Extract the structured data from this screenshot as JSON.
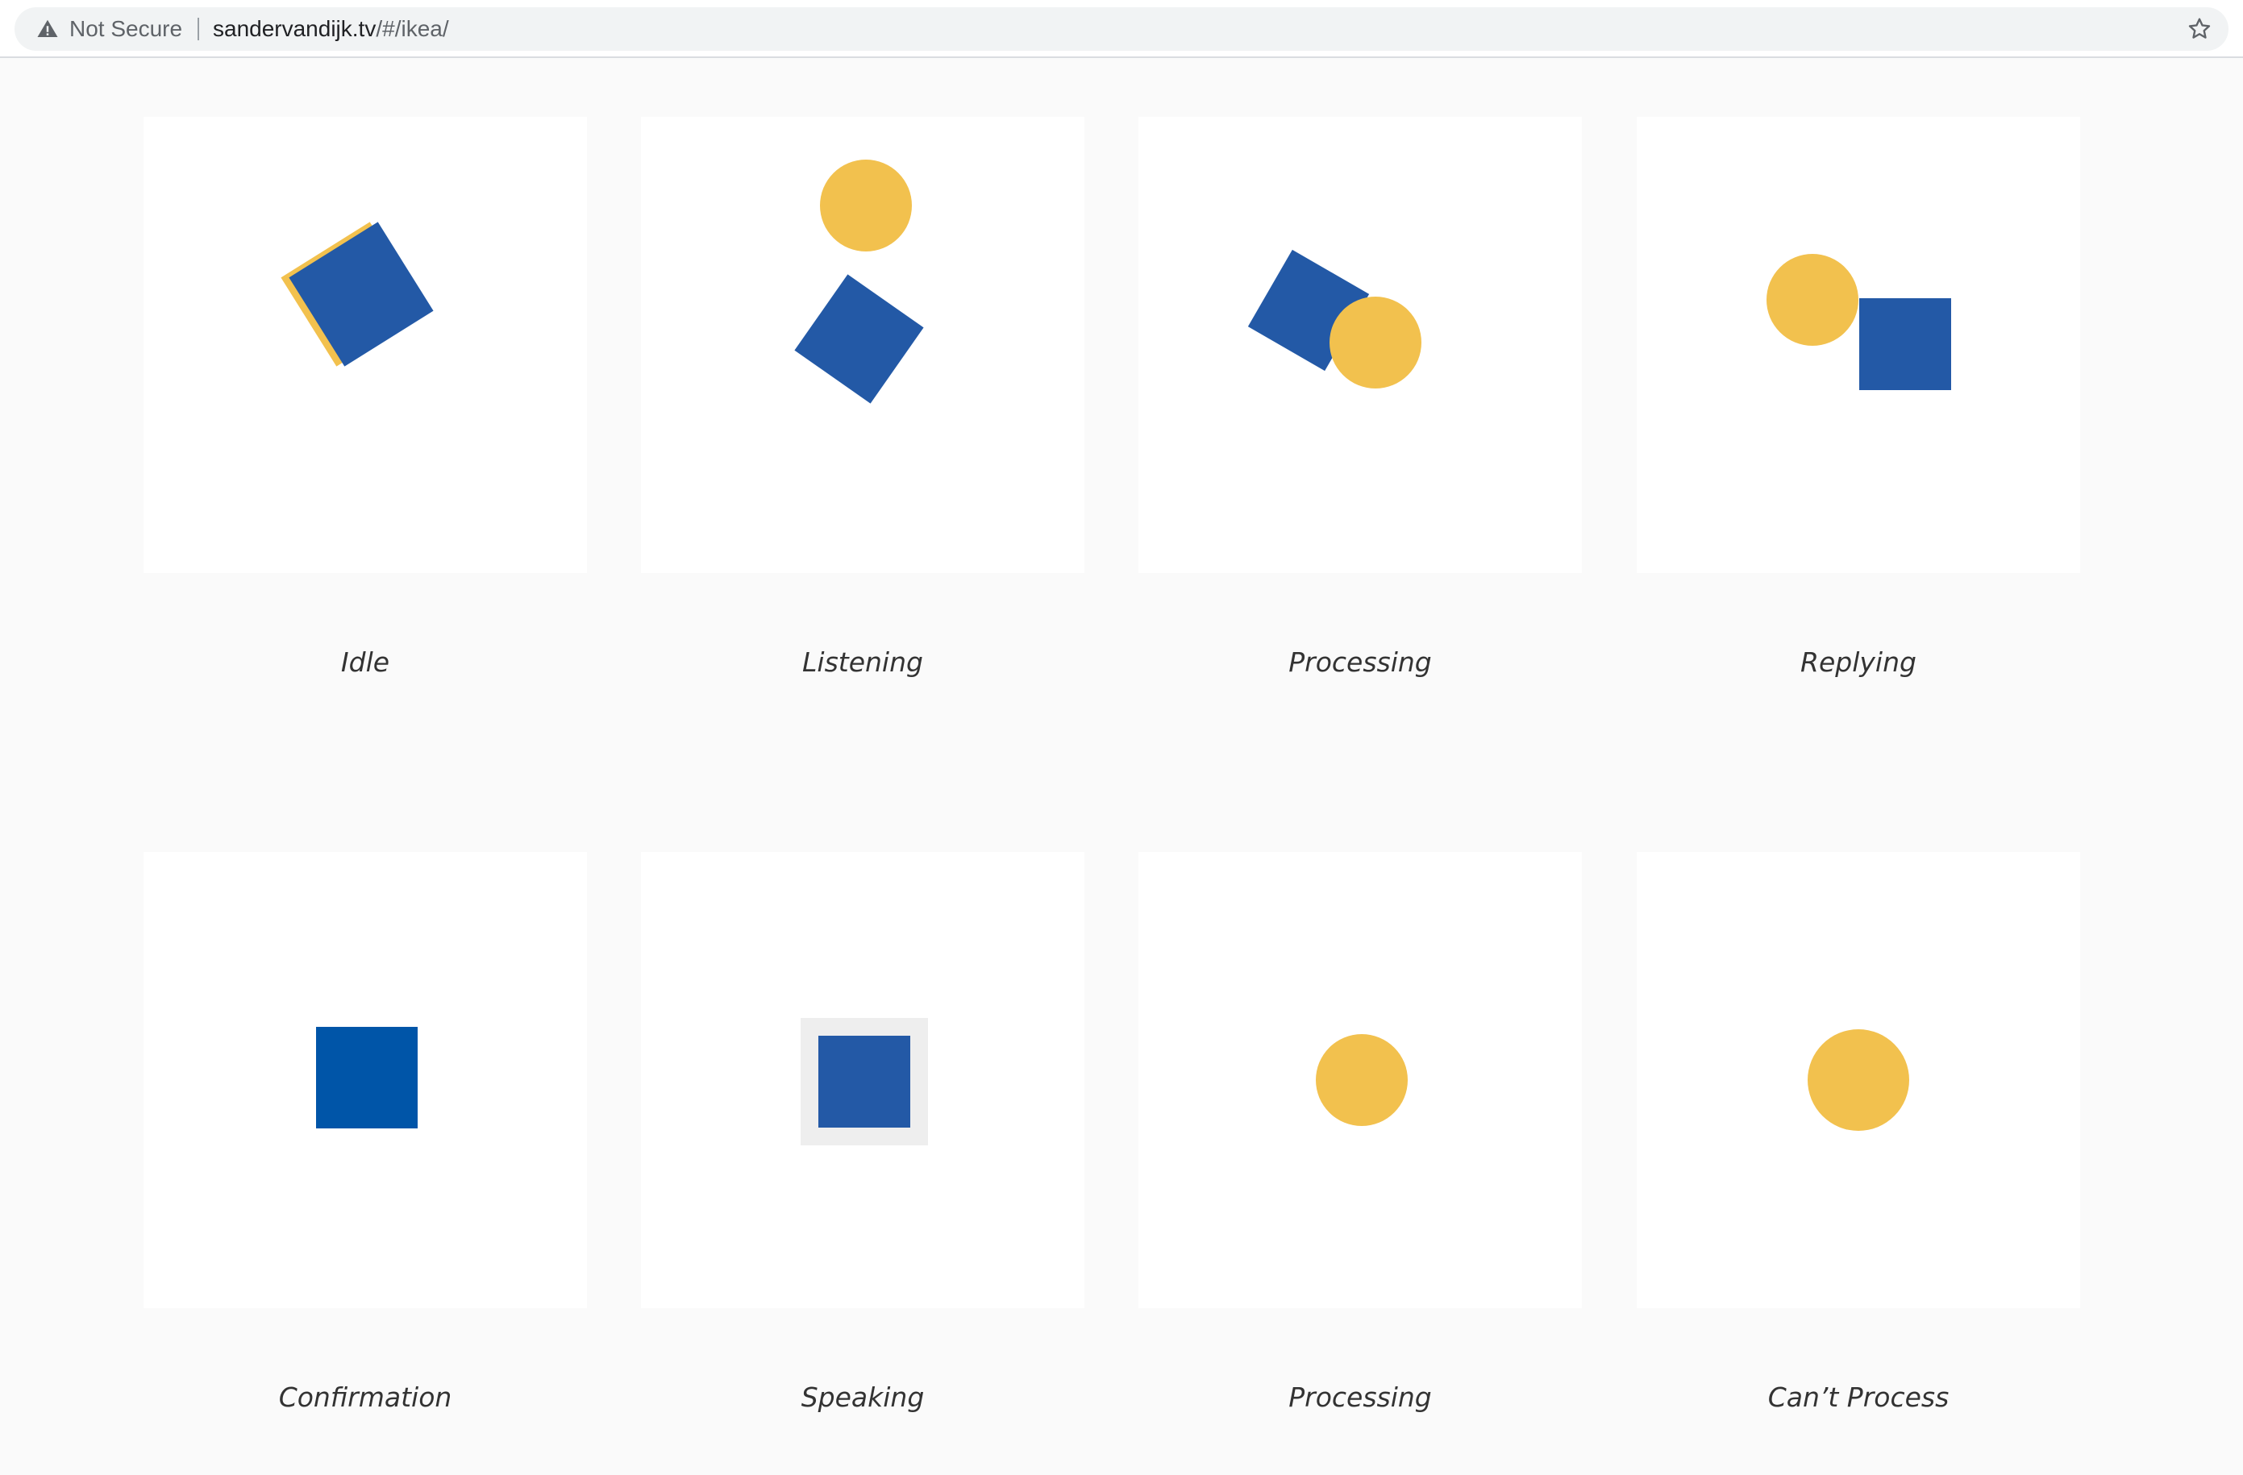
{
  "browser": {
    "security_label": "Not Secure",
    "url_host": "sandervandijk.tv",
    "url_path": "/#/ikea/",
    "icons": {
      "security": "warning-triangle-icon",
      "bookmark": "star-icon"
    }
  },
  "colors": {
    "page_background": "#fafafa",
    "card_background": "#ffffff",
    "blue": "#2359a6",
    "blue_alt": "#0055a8",
    "yellow": "#f2c14e"
  },
  "states": [
    {
      "label": "Idle"
    },
    {
      "label": "Listening"
    },
    {
      "label": "Processing"
    },
    {
      "label": "Replying"
    },
    {
      "label": "Confirmation"
    },
    {
      "label": "Speaking"
    },
    {
      "label": "Processing"
    },
    {
      "label": "Can’t Process"
    }
  ]
}
